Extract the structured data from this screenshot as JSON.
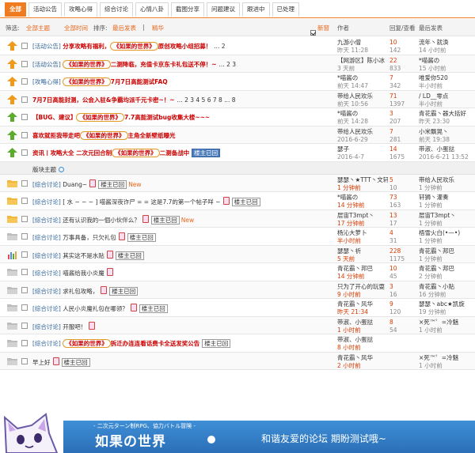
{
  "tabs": [
    "全部",
    "活动公告",
    "攻略心得",
    "综合讨论",
    "心情八卦",
    "截图分享",
    "问题建议",
    "跟进中",
    "已处理"
  ],
  "filter": {
    "label": "筛选:",
    "all_subject": "全部主题",
    "all_time": "全部时间",
    "sort_label": "排序:",
    "latest_reply": "最后发表",
    "digest": "精华",
    "new_window": "新窗",
    "col_author": "作者",
    "col_reply": "回复/查看",
    "col_last": "最后发表"
  },
  "separator": {
    "text": "版块主题"
  },
  "threads": [
    {
      "icon": "up-arrow-icon",
      "cat": "[活动公告]",
      "prefix": "分享攻略有福利，",
      "hl": "《如果的世界》",
      "suffix": "原创攻略小组招募！",
      "pages": "... 2",
      "tags": [],
      "author": "九游小僧",
      "atime": "昨天 11:28",
      "replies": "10",
      "views": "142",
      "last": "流年丶就涣",
      "ltime": "14 小时前",
      "bold": true
    },
    {
      "icon": "up-arrow-icon",
      "cat": "[活动公告]",
      "prefix": "",
      "hl": "《如果的世界》",
      "suffix": "二测降临，充值卡京东卡礼包送不停！~",
      "pages": "... 2 3",
      "tags": [],
      "author": "【网游区】陈小冰",
      "atime": "3 天前",
      "replies": "22",
      "views": "833",
      "last": "*喵酱の",
      "ltime": "15 小时前",
      "bold": true
    },
    {
      "icon": "up-arrow-icon",
      "cat": "[攻略心得]",
      "prefix": "",
      "hl": "《如果的世界》",
      "suffix": "7月7日高能测试FAQ",
      "pages": "",
      "tags": [],
      "author": "*喵酱の",
      "atime": "前天 14:47",
      "replies": "7",
      "views": "342",
      "last": "唯爱你520",
      "ltime": "半小时前",
      "bold": true
    },
    {
      "icon": "up-arrow-icon",
      "cat": "",
      "prefix": "7月7日高能封测，公会入驻&争霸均派千元卡密~！~",
      "hl": "",
      "suffix": "",
      "pages": "... 2 3 4 5 6 7 8 ... 8",
      "tags": [],
      "author": "带给人民欢乐",
      "atime": "前天 10:56",
      "replies": "71",
      "views": "1397",
      "last": "/ LD__零点",
      "ltime": "半小时前",
      "bold": true
    },
    {
      "icon": "up-arrow-green-icon",
      "cat": "",
      "prefix": "【BUG、建议】",
      "hl": "《如果的世界》",
      "suffix": "7.7高能测试bug收集大楼~~~",
      "pages": "",
      "tags": [],
      "author": "*喵酱の",
      "atime": "前天 14:28",
      "replies": "3",
      "views": "207",
      "last": "青花霸丶器大括好",
      "ltime": "昨天 23:30",
      "bold": true
    },
    {
      "icon": "up-arrow-green-icon",
      "cat": "",
      "prefix": "喜欢就拒我带走吧",
      "hl": "《如果的世界》",
      "suffix": "主角全新壁纸曝光",
      "pages": "",
      "tags": [],
      "author": "带给人民欢乐",
      "atime": "2016-6-29",
      "replies": "7",
      "views": "281",
      "last": "小米飘晃丶",
      "ltime": "前天 19:38",
      "bold": true
    },
    {
      "icon": "up-arrow-green-icon",
      "cat": "",
      "prefix": "资讯丨攻略大全 二次元回合制",
      "hl": "《如果的世界》",
      "suffix": "二测备战中",
      "pages": "",
      "tags": [
        "楼主已回"
      ],
      "author": "瑟子",
      "atime": "2016-4-7",
      "replies": "14",
      "views": "1675",
      "last": "带淑、小蛋挞",
      "ltime": "2016-6-21 13:52",
      "bold": true
    },
    {
      "icon": "folder-icon",
      "cat": "[综合讨论]",
      "prefix": "Duang~",
      "hl": "",
      "suffix": "",
      "pages": "",
      "tags": [
        "楼主已回"
      ],
      "new": "New",
      "author": "瑟瑟丶★TTT丶文轩",
      "atime": "1 分钟前",
      "replies": "5",
      "views": "10",
      "last": "带给人民欢乐",
      "ltime": "1 分钟前",
      "bold": false
    },
    {
      "icon": "folder-icon",
      "cat": "[综合讨论]",
      "prefix": "[ 水 ~ ~ ~ ] 喵酱深夜诈尸 = = 这是7.7的第一个帖子咩 ~",
      "hl": "",
      "suffix": "",
      "pages": "",
      "tags": [
        "楼主已回"
      ],
      "author": "*喵酱の",
      "atime": "14 分钟前",
      "replies": "73",
      "views": "163",
      "last": "轩狮丶灌奏",
      "ltime": "1 分钟前",
      "bold": false
    },
    {
      "icon": "folder-icon",
      "cat": "[综合讨论]",
      "prefix": "还有认识我的一個小伙伴么？",
      "hl": "",
      "suffix": "",
      "pages": "",
      "tags": [
        "楼主已回"
      ],
      "new": "New",
      "author": "层宙T3mpt丶",
      "atime": "17 分钟前",
      "replies": "13",
      "views": "17",
      "last": "层宙T3mpt丶",
      "ltime": "1 分钟前",
      "bold": false
    },
    {
      "icon": "folder-gray-icon",
      "cat": "[综合讨论]",
      "prefix": "万事具备，只欠礼包",
      "hl": "",
      "suffix": "",
      "pages": "",
      "tags": [
        "楼主已回"
      ],
      "author": "杨沁大萝卜",
      "atime": "半小时前",
      "replies": "4",
      "views": "31",
      "last": "梧雪火白(•—•)",
      "ltime": "1 分钟前",
      "bold": false
    },
    {
      "icon": "bar-chart-icon",
      "cat": "[综合讨论]",
      "prefix": "其实这不是水贴",
      "hl": "",
      "suffix": "",
      "pages": "",
      "tags": [
        "楼主已回"
      ],
      "author": "瑟瑟丶祈",
      "atime": "5 天前",
      "replies": "228",
      "views": "1175",
      "last": "青花霸丶邦巴",
      "ltime": "1 分钟前",
      "bold": false
    },
    {
      "icon": "folder-gray-icon",
      "cat": "[综合讨论]",
      "prefix": "喵酱给我小炎魔",
      "hl": "",
      "suffix": "",
      "pages": "",
      "tags": [],
      "author": "青花霸丶邦巴",
      "atime": "14 分钟前",
      "replies": "10",
      "views": "45",
      "last": "青花霸丶邦巴",
      "ltime": "2 分钟前",
      "bold": false
    },
    {
      "icon": "folder-gray-icon",
      "cat": "[综合讨论]",
      "prefix": "求礼包攻略，",
      "hl": "",
      "suffix": "",
      "pages": "",
      "tags": [
        "楼主已回"
      ],
      "author": "只为了开心的玩耍",
      "atime": "9 小时前",
      "replies": "3",
      "views": "16",
      "last": "青花霸丶小贴",
      "ltime": "16 分钟前",
      "bold": false
    },
    {
      "icon": "folder-gray-icon",
      "cat": "[综合讨论]",
      "prefix": "人民小炎魔礼包在哪领？",
      "hl": "",
      "suffix": "",
      "pages": "",
      "tags": [
        "楼主已回"
      ],
      "author": "青花霸丶风华",
      "atime": "昨天 21:34",
      "replies": "9",
      "views": "120",
      "last": "瑟瑟丶abc★凯旋",
      "ltime": "19 分钟前",
      "bold": false
    },
    {
      "icon": "folder-gray-icon",
      "cat": "[综合讨论]",
      "prefix": "开服吧！",
      "hl": "",
      "suffix": "",
      "pages": "",
      "tags": [],
      "author": "带淑、小蛋挞",
      "atime": "1 小时前",
      "replies": "8",
      "views": "54",
      "last": "×死™゜=冷魅",
      "ltime": "1 小时前",
      "bold": false
    },
    {
      "icon": "folder-gray-icon",
      "cat": "[综合讨论]",
      "prefix": "",
      "hl": "《如果的世界》",
      "suffix": "拆迁办连连看话费卡全送发奖公告",
      "pages": "",
      "tags": [
        "楼主已回"
      ],
      "author": "带淑、小蛋挞",
      "atime": "8 小时前",
      "replies": "",
      "views": "",
      "last": "",
      "ltime": "",
      "bold": true
    },
    {
      "icon": "folder-gray-icon",
      "cat": "",
      "prefix": "早上好",
      "hl": "",
      "suffix": "",
      "pages": "",
      "tags": [
        "楼主已回"
      ],
      "author": "青花霸丶风华",
      "atime": "2 小时前",
      "replies": "",
      "views": "",
      "last": "×死™゜=冷魅",
      "ltime": "1 小时前",
      "bold": false
    }
  ],
  "banner": {
    "sub": "- 二次元ターン制RPG、協力バトル冒険 -",
    "logo": "如果の世界",
    "slogan": "和谐友爱的论坛 期盼测试哦~"
  }
}
